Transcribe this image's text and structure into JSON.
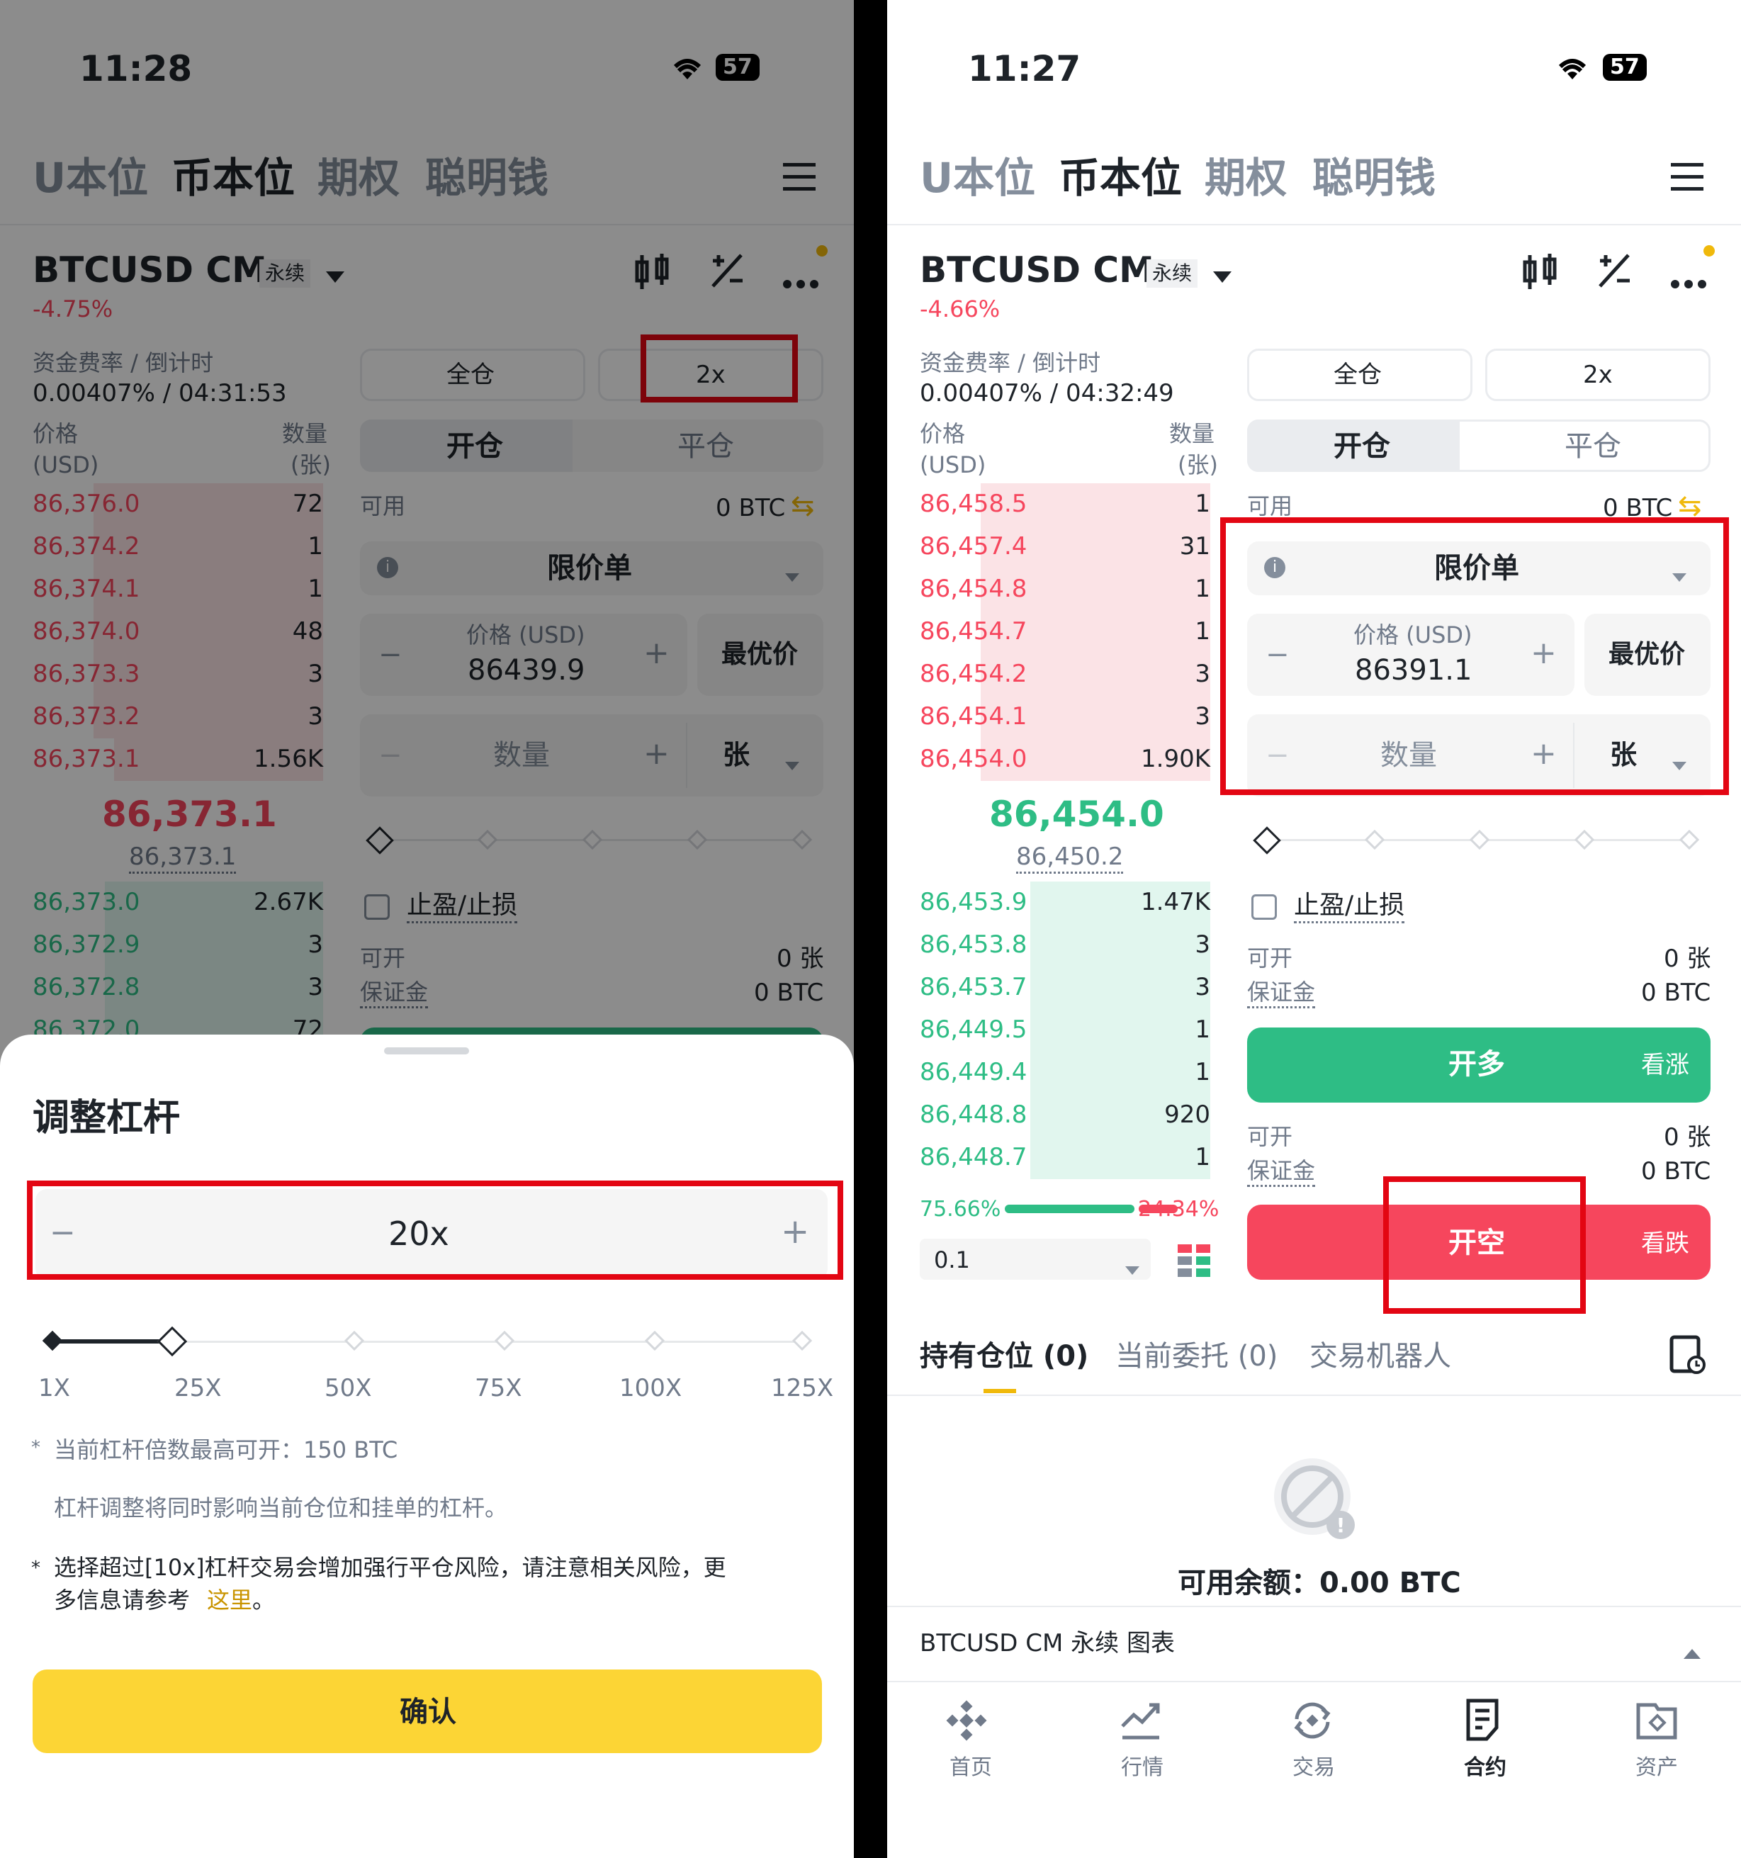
{
  "left": {
    "status_time": "11:28",
    "battery": "57",
    "nav_tabs": [
      "U本位",
      "币本位",
      "期权",
      "聪明钱"
    ],
    "symbol": "BTCUSD CM",
    "perp_badge": "永续",
    "change": "-4.75%",
    "funding_label": "资金费率 / 倒计时",
    "funding_value": "0.00407% / 04:31:53",
    "price_header": "价格",
    "price_unit": "(USD)",
    "qty_header": "数量",
    "qty_unit": "(张)",
    "asks": [
      {
        "price": "86,376.0",
        "qty": "72",
        "depth": 0.79
      },
      {
        "price": "86,374.2",
        "qty": "1",
        "depth": 0.79
      },
      {
        "price": "86,374.1",
        "qty": "1",
        "depth": 0.79
      },
      {
        "price": "86,374.0",
        "qty": "48",
        "depth": 0.79
      },
      {
        "price": "86,373.3",
        "qty": "3",
        "depth": 0.79
      },
      {
        "price": "86,373.2",
        "qty": "3",
        "depth": 0.79
      },
      {
        "price": "86,373.1",
        "qty": "1.56K",
        "depth": 0.72
      }
    ],
    "last_price": "86,373.1",
    "mark_price": "86,373.1",
    "bids": [
      {
        "price": "86,373.0",
        "qty": "2.67K",
        "depth": 0.75
      },
      {
        "price": "86,372.9",
        "qty": "3",
        "depth": 0.75
      },
      {
        "price": "86,372.8",
        "qty": "3",
        "depth": 0.75
      },
      {
        "price": "86,372.0",
        "qty": "72",
        "depth": 0.75
      }
    ],
    "margin_mode": "全仓",
    "leverage": "2x",
    "open_tab": "开仓",
    "close_tab": "平仓",
    "available_label": "可用",
    "available_value": "0 BTC",
    "order_type": "限价单",
    "price_label": "价格 (USD)",
    "price_value": "86439.9",
    "best_price": "最优价",
    "qty_placeholder": "数量",
    "qty_unit_select": "张",
    "tpsl": "止盈/止损",
    "can_open_label": "可开",
    "can_open_value": "0 张",
    "margin_label": "保证金",
    "margin_value": "0 BTC",
    "sheet": {
      "title": "调整杠杆",
      "leverage_value": "20x",
      "leverage_fraction": 0.16,
      "ticks": [
        "1X",
        "25X",
        "50X",
        "75X",
        "100X",
        "125X"
      ],
      "note1": "当前杠杆倍数最高可开：150 BTC",
      "note2": "杠杆调整将同时影响当前仓位和挂单的杠杆。",
      "warn": "选择超过[10x]杠杆交易会增加强行平仓风险，请注意相关风险，更",
      "warn2": "多信息请参考",
      "link": "这里",
      "warn_end": "。",
      "confirm": "确认"
    }
  },
  "right": {
    "status_time": "11:27",
    "battery": "57",
    "nav_tabs": [
      "U本位",
      "币本位",
      "期权",
      "聪明钱"
    ],
    "symbol": "BTCUSD CM",
    "perp_badge": "永续",
    "change": "-4.66%",
    "funding_label": "资金费率 / 倒计时",
    "funding_value": "0.00407% / 04:32:49",
    "price_header": "价格",
    "price_unit": "(USD)",
    "qty_header": "数量",
    "qty_unit": "(张)",
    "asks": [
      {
        "price": "86,458.5",
        "qty": "1",
        "depth": 0.79
      },
      {
        "price": "86,457.4",
        "qty": "31",
        "depth": 0.79
      },
      {
        "price": "86,454.8",
        "qty": "1",
        "depth": 0.79
      },
      {
        "price": "86,454.7",
        "qty": "1",
        "depth": 0.79
      },
      {
        "price": "86,454.2",
        "qty": "3",
        "depth": 0.79
      },
      {
        "price": "86,454.1",
        "qty": "3",
        "depth": 0.79
      },
      {
        "price": "86,454.0",
        "qty": "1.90K",
        "depth": 0.79
      }
    ],
    "last_price": "86,454.0",
    "mark_price": "86,450.2",
    "bids": [
      {
        "price": "86,453.9",
        "qty": "1.47K",
        "depth": 0.62
      },
      {
        "price": "86,453.8",
        "qty": "3",
        "depth": 0.62
      },
      {
        "price": "86,453.7",
        "qty": "3",
        "depth": 0.62
      },
      {
        "price": "86,449.5",
        "qty": "1",
        "depth": 0.62
      },
      {
        "price": "86,449.4",
        "qty": "1",
        "depth": 0.62
      },
      {
        "price": "86,448.8",
        "qty": "920",
        "depth": 0.62
      },
      {
        "price": "86,448.7",
        "qty": "1",
        "depth": 0.62
      }
    ],
    "buy_ratio": "75.66%",
    "sell_ratio": "24.34%",
    "buy_fraction": 0.7566,
    "precision": "0.1",
    "margin_mode": "全仓",
    "leverage": "2x",
    "open_tab": "开仓",
    "close_tab": "平仓",
    "available_label": "可用",
    "available_value": "0 BTC",
    "order_type": "限价单",
    "price_label": "价格 (USD)",
    "price_value": "86391.1",
    "best_price": "最优价",
    "qty_placeholder": "数量",
    "qty_unit_select": "张",
    "tpsl": "止盈/止损",
    "can_open_label": "可开",
    "can_open_value": "0 张",
    "margin_label": "保证金",
    "margin_value": "0 BTC",
    "long_btn": "开多",
    "long_hint": "看涨",
    "short_btn": "开空",
    "short_hint": "看跌",
    "bottom_tabs": [
      "持有仓位 (0)",
      "当前委托 (0)",
      "交易机器人"
    ],
    "empty_balance": "可用余额：0.00 BTC",
    "chart_bar": "BTCUSD CM 永续  图表",
    "tabbar": [
      "首页",
      "行情",
      "交易",
      "合约",
      "资产"
    ]
  },
  "colors": {
    "accent_yellow": "#fcd535",
    "buy_green": "#2ebd85",
    "sell_red": "#f6465d",
    "highlight_box": "#e30613",
    "link_gold": "#c99400"
  }
}
